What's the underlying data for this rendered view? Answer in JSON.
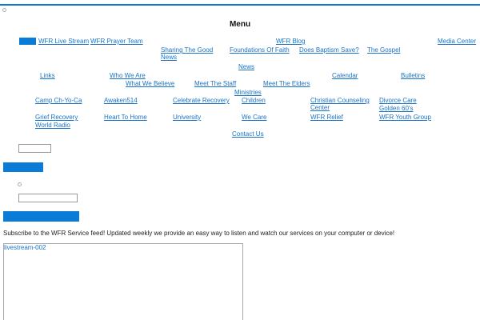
{
  "menu": {
    "title": "Menu",
    "links": {
      "wfr_live_stream": "WFR Live Stream",
      "wfr_prayer_team": "WFR Prayer Team",
      "wfr_blog": "WFR Blog",
      "media_center": "Media Center",
      "sharing_the_good_news": "Sharing The Good News",
      "foundations_of_faith": "Foundations Of Faith",
      "does_baptism_save": "Does Baptism Save?",
      "the_gospel": "The Gospel",
      "news": "News",
      "links": "Links",
      "who_we_are": "Who We Are",
      "calendar": "Calendar",
      "bulletins": "Bulletins",
      "what_we_believe": "What We Believe",
      "meet_the_staff": "Meet The Staff",
      "meet_the_elders": "Meet The Elders",
      "ministries": "Ministries",
      "camp_ch_yo_ca": "Camp Ch-Yo-Ca",
      "awaken514": "Awaken514",
      "celebrate_recovery": "Celebrate Recovery",
      "children": "Children",
      "christian_counseling_center": "Christian Counseling Center",
      "divorce_care": "Divorce Care",
      "golden_60s": "Golden 60's",
      "grief_recovery": "Grief Recovery",
      "heart_to_home": "Heart To Home",
      "university": "University",
      "we_care": "We Care",
      "wfr_relief": "WFR Relief",
      "wfr_youth_group": "WFR Youth Group",
      "world_radio": "World Radio",
      "contact_us": "Contact Us"
    }
  },
  "subscribe": {
    "text": "Subscribe to the WFR Service feed! Updated weekly we provide an easy way to listen and watch our services on your computer or device!"
  },
  "embed": {
    "title": "livestream-002"
  },
  "colors": {
    "accent": "#0a7bd6",
    "link": "#1a73c7"
  }
}
